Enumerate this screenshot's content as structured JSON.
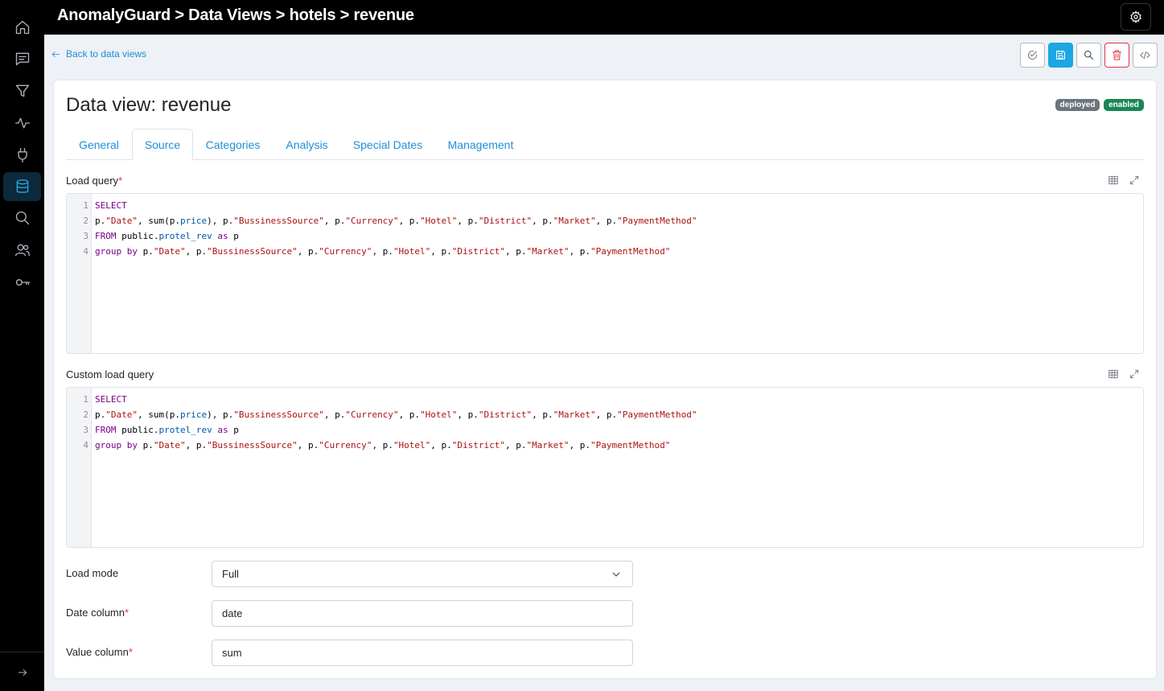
{
  "header": {
    "title": "AnomalyGuard > Data Views > hotels > revenue"
  },
  "sidebar": {
    "items": [
      {
        "icon": "home-icon"
      },
      {
        "icon": "chat-icon"
      },
      {
        "icon": "filter-icon"
      },
      {
        "icon": "activity-icon"
      },
      {
        "icon": "plug-icon"
      },
      {
        "icon": "database-icon",
        "active": true
      },
      {
        "icon": "search-icon"
      },
      {
        "icon": "users-icon"
      },
      {
        "icon": "key-icon"
      }
    ],
    "expand_icon": "arrow-right-icon"
  },
  "nav": {
    "back_label": "Back to data views"
  },
  "toolbar": {
    "buttons": [
      "validate-icon",
      "save-icon",
      "search-icon",
      "trash-icon",
      "code-icon"
    ]
  },
  "page": {
    "title": "Data view: revenue",
    "badges": {
      "deployed": "deployed",
      "enabled": "enabled"
    }
  },
  "tabs": [
    "General",
    "Source",
    "Categories",
    "Analysis",
    "Special Dates",
    "Management"
  ],
  "active_tab": "Source",
  "load_query": {
    "label": "Load query",
    "required_mark": "*",
    "lines": [
      "SELECT",
      "p.\"Date\", sum(p.price), p.\"BussinessSource\", p.\"Currency\", p.\"Hotel\", p.\"District\", p.\"Market\", p.\"PaymentMethod\"",
      "FROM public.protel_rev as p",
      "group by p.\"Date\", p.\"BussinessSource\", p.\"Currency\", p.\"Hotel\", p.\"District\", p.\"Market\", p.\"PaymentMethod\""
    ]
  },
  "custom_load_query": {
    "label": "Custom load query",
    "lines": [
      "SELECT",
      "p.\"Date\", sum(p.price), p.\"BussinessSource\", p.\"Currency\", p.\"Hotel\", p.\"District\", p.\"Market\", p.\"PaymentMethod\"",
      "FROM public.protel_rev as p",
      "group by p.\"Date\", p.\"BussinessSource\", p.\"Currency\", p.\"Hotel\", p.\"District\", p.\"Market\", p.\"PaymentMethod\""
    ]
  },
  "form": {
    "load_mode": {
      "label": "Load mode",
      "value": "Full"
    },
    "date_column": {
      "label": "Date column",
      "required_mark": "*",
      "value": "date"
    },
    "value_column": {
      "label": "Value column",
      "required_mark": "*",
      "value": "sum"
    }
  },
  "colors": {
    "accent": "#1d8fd6",
    "save_button": "#1ba7e3",
    "danger": "#dc3545",
    "badge_deployed": "#6c757d",
    "badge_enabled": "#198754",
    "sql_keyword": "#770088",
    "sql_string": "#aa1111"
  }
}
